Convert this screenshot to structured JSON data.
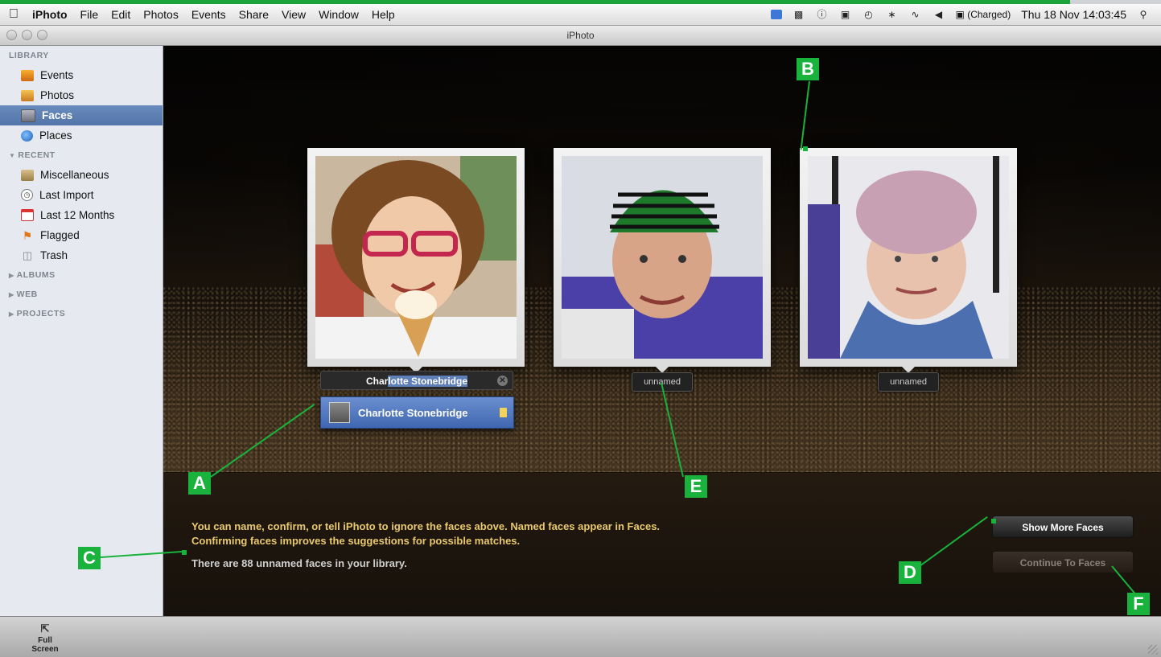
{
  "menubar": {
    "apple_icon": "apple-icon",
    "app_name": "iPhoto",
    "items": [
      "File",
      "Edit",
      "Photos",
      "Events",
      "Share",
      "View",
      "Window",
      "Help"
    ],
    "battery_text": "(Charged)",
    "clock": "Thu 18 Nov  14:03:45"
  },
  "window": {
    "title": "iPhoto"
  },
  "sidebar": {
    "library_header": "LIBRARY",
    "library": [
      {
        "label": "Events",
        "icon": "events-icon"
      },
      {
        "label": "Photos",
        "icon": "photos-icon"
      },
      {
        "label": "Faces",
        "icon": "faces-icon",
        "selected": true
      },
      {
        "label": "Places",
        "icon": "globe-icon"
      }
    ],
    "recent_header": "RECENT",
    "recent": [
      {
        "label": "Miscellaneous",
        "icon": "event-icon"
      },
      {
        "label": "Last Import",
        "icon": "clock-icon"
      },
      {
        "label": "Last 12 Months",
        "icon": "calendar-icon"
      },
      {
        "label": "Flagged",
        "icon": "flag-icon"
      },
      {
        "label": "Trash",
        "icon": "trash-icon"
      }
    ],
    "albums_header": "ALBUMS",
    "web_header": "WEB",
    "projects_header": "PROJECTS"
  },
  "faces": {
    "editing_name_typed": "Char",
    "editing_name_completion": "lotte Stonebridge",
    "suggestion": "Charlotte Stonebridge",
    "face2_label": "unnamed",
    "face3_label": "unnamed"
  },
  "panel": {
    "hint_line1": "You can name, confirm, or tell iPhoto to ignore the faces above. Named faces appear in Faces.",
    "hint_line2": "Confirming faces improves the suggestions for possible matches.",
    "count_text": "There are 88 unnamed faces in your library.",
    "show_more_label": "Show More Faces",
    "continue_label": "Continue To Faces"
  },
  "annotations": [
    "A",
    "B",
    "C",
    "D",
    "E",
    "F"
  ],
  "toolbar": {
    "full_screen_label": "Full Screen"
  },
  "colors": {
    "annotation_green": "#19b23c",
    "hint_text": "#e9c86f",
    "selection_blue": "#5274a8"
  }
}
